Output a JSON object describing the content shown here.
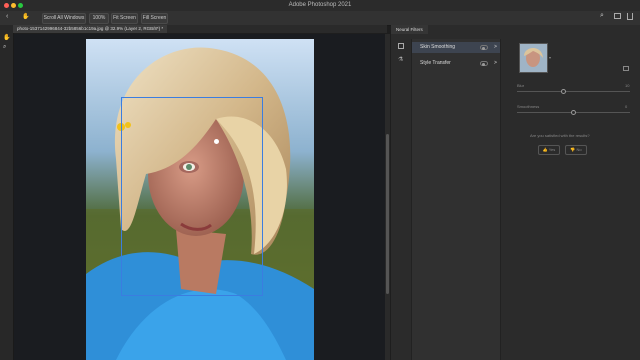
{
  "app": {
    "title": "Adobe Photoshop 2021"
  },
  "colors": {
    "traffic_close": "#ff5f57",
    "traffic_min": "#febc2e",
    "traffic_max": "#28c840",
    "selection": "#3b7de0"
  },
  "options_bar": {
    "scroll_all_windows": "Scroll All Windows",
    "zoom_100": "100%",
    "fit_screen": "Fit Screen",
    "fill_screen": "Fill Screen"
  },
  "document": {
    "tab_label": "photo-1537142996844-32b5856b1c19a.jpg @ 32.9% (Layer 2, RGB/8*) *"
  },
  "panel": {
    "tab_label": "Neural Filters",
    "filters": [
      {
        "label": "Skin Smoothing",
        "chevron": ">"
      },
      {
        "label": "Style Transfer",
        "chevron": ">"
      }
    ],
    "blur_label": "Blur",
    "blur_value": "10",
    "smoothness_label": "Smoothness",
    "smoothness_value": "0",
    "question": "Are you satisfied with the results?",
    "yes_label": "Yes",
    "no_label": "No"
  }
}
